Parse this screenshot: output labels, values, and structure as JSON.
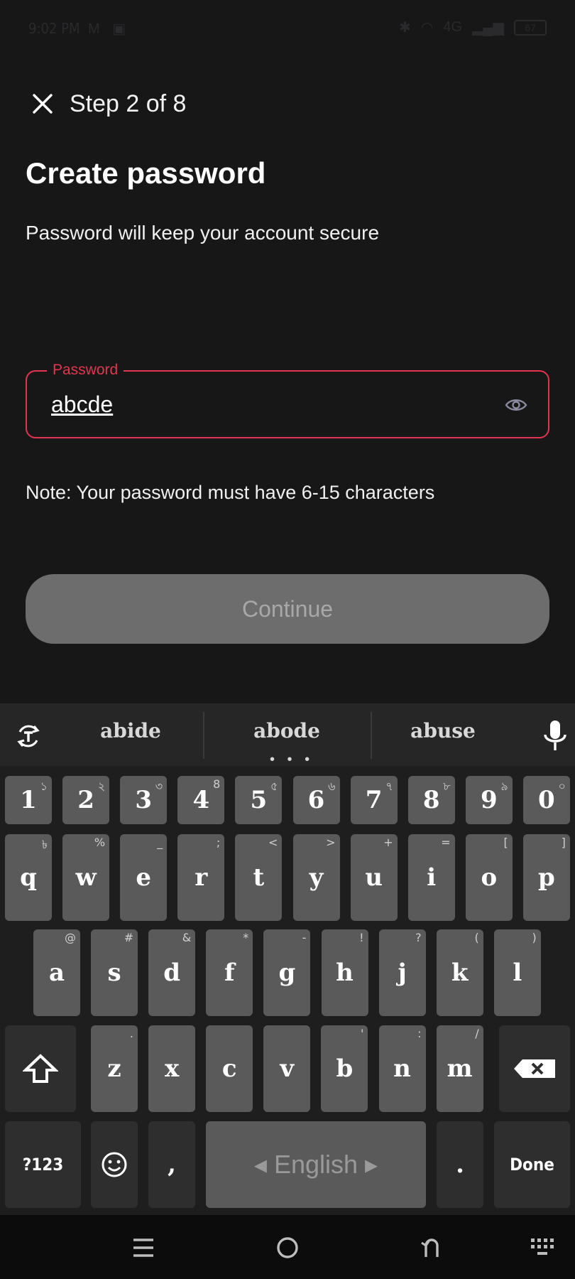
{
  "status_bar": {
    "time": "9:02 PM",
    "left_icons": "M ▣",
    "network": "4G",
    "battery": "67"
  },
  "header": {
    "step_label": "Step 2 of 8"
  },
  "main": {
    "title": "Create password",
    "subtitle": "Password will keep your account secure",
    "password_field": {
      "label": "Password",
      "value": "abcde"
    },
    "note": "Note: Your password must have 6-15 characters",
    "continue_label": "Continue"
  },
  "keyboard": {
    "suggestions": [
      "abide",
      "abode",
      "abuse"
    ],
    "suggestion_dots": "• • •",
    "number_row": [
      {
        "label": "1",
        "hint": "১"
      },
      {
        "label": "2",
        "hint": "২"
      },
      {
        "label": "3",
        "hint": "৩"
      },
      {
        "label": "4",
        "hint": "8"
      },
      {
        "label": "5",
        "hint": "৫"
      },
      {
        "label": "6",
        "hint": "৬"
      },
      {
        "label": "7",
        "hint": "৭"
      },
      {
        "label": "8",
        "hint": "৮"
      },
      {
        "label": "9",
        "hint": "৯"
      },
      {
        "label": "0",
        "hint": "০"
      }
    ],
    "row1": [
      {
        "label": "q",
        "hint": "৳"
      },
      {
        "label": "w",
        "hint": "%"
      },
      {
        "label": "e",
        "hint": "_"
      },
      {
        "label": "r",
        "hint": ";"
      },
      {
        "label": "t",
        "hint": "<"
      },
      {
        "label": "y",
        "hint": ">"
      },
      {
        "label": "u",
        "hint": "+"
      },
      {
        "label": "i",
        "hint": "="
      },
      {
        "label": "o",
        "hint": "["
      },
      {
        "label": "p",
        "hint": "]"
      }
    ],
    "row2": [
      {
        "label": "a",
        "hint": "@"
      },
      {
        "label": "s",
        "hint": "#"
      },
      {
        "label": "d",
        "hint": "&"
      },
      {
        "label": "f",
        "hint": "*"
      },
      {
        "label": "g",
        "hint": "-"
      },
      {
        "label": "h",
        "hint": "!"
      },
      {
        "label": "j",
        "hint": "?"
      },
      {
        "label": "k",
        "hint": "("
      },
      {
        "label": "l",
        "hint": ")"
      }
    ],
    "row3": [
      {
        "label": "z",
        "hint": "."
      },
      {
        "label": "x",
        "hint": ""
      },
      {
        "label": "c",
        "hint": ""
      },
      {
        "label": "v",
        "hint": ""
      },
      {
        "label": "b",
        "hint": "'"
      },
      {
        "label": "n",
        "hint": ":"
      },
      {
        "label": "m",
        "hint": "/"
      }
    ],
    "symbols_label": "?123",
    "comma_label": ",",
    "space_label": "◂ English ▸",
    "period_label": ".",
    "done_label": "Done"
  }
}
